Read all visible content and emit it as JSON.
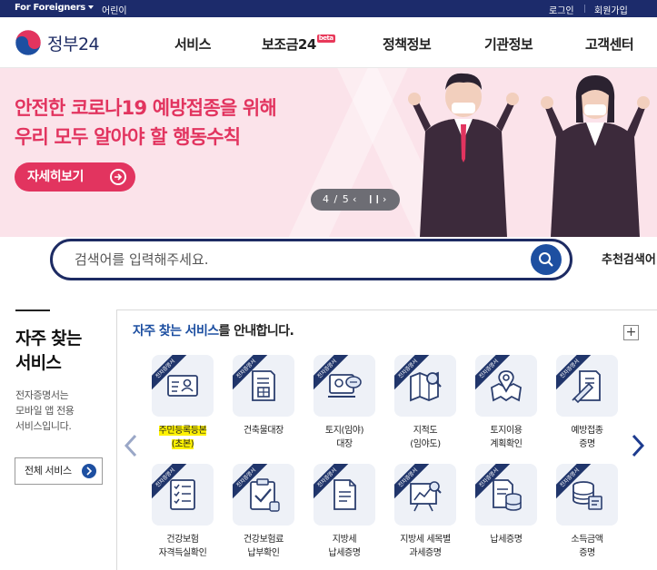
{
  "topbar": {
    "foreigners": "For Foreigners",
    "kids": "어린이",
    "login": "로그인",
    "join": "회원가입"
  },
  "header": {
    "logo_text": "정부24",
    "nav": [
      {
        "label": "서비스"
      },
      {
        "label": "보조금24",
        "badge": "beta"
      },
      {
        "label": "정책정보"
      },
      {
        "label": "기관정보"
      },
      {
        "label": "고객센터"
      }
    ]
  },
  "banner": {
    "title_line1": "안전한 코로나19 예방접종을 위해",
    "title_line2": "우리 모두 알아야 할 행동수칙",
    "more_label": "자세히보기",
    "pager": {
      "current": "4",
      "total": "5",
      "text": "4 / 5"
    }
  },
  "search": {
    "placeholder": "검색어를 입력해주세요.",
    "recommend_label": "추천검색어"
  },
  "left_panel": {
    "title_line1": "자주 찾는",
    "title_line2": "서비스",
    "desc_line1": "전자증명서는",
    "desc_line2": "모바일 앱 전용",
    "desc_line3": "서비스입니다.",
    "all_services_label": "전체 서비스"
  },
  "services": {
    "heading_highlight": "자주 찾는 서비스",
    "heading_rest": "를 안내합니다.",
    "plus_label": "+",
    "ribbon": "전자증명서",
    "items": [
      {
        "line1": "주민등록등본",
        "line2": "(초본)",
        "icon": "id-card-icon",
        "highlight": true
      },
      {
        "line1": "건축물대장",
        "line2": "",
        "icon": "building-doc-icon"
      },
      {
        "line1": "토지(임야)",
        "line2": "대장",
        "icon": "land-chat-icon"
      },
      {
        "line1": "지적도",
        "line2": "(임야도)",
        "icon": "map-search-icon"
      },
      {
        "line1": "토지이용",
        "line2": "계획확인",
        "icon": "map-pin-icon"
      },
      {
        "line1": "예방접종",
        "line2": "증명",
        "icon": "syringe-doc-icon"
      },
      {
        "line1": "건강보험",
        "line2": "자격득실확인",
        "icon": "checklist-icon"
      },
      {
        "line1": "건강보험료",
        "line2": "납부확인",
        "icon": "clipboard-check-icon"
      },
      {
        "line1": "지방세",
        "line2": "납세증명",
        "icon": "document-icon"
      },
      {
        "line1": "지방세 세목별",
        "line2": "과세증명",
        "icon": "chart-board-icon"
      },
      {
        "line1": "납세증명",
        "line2": "",
        "icon": "coin-doc-icon"
      },
      {
        "line1": "소득금액",
        "line2": "증명",
        "icon": "coins-icon"
      }
    ]
  }
}
